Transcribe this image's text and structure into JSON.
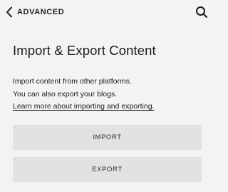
{
  "header": {
    "back_label": "ADVANCED",
    "back_icon": "chevron-left-icon",
    "search_icon": "search-icon"
  },
  "main": {
    "title": "Import & Export Content",
    "description_line1": "Import content from other platforms.",
    "description_line2": "You can also export your blogs.",
    "learn_more_link": "Learn more about importing and exporting.",
    "import_button": "IMPORT",
    "export_button": "EXPORT"
  },
  "colors": {
    "background": "#f3f3f3",
    "button_background": "#e2e2e2",
    "text": "#1d1d1d"
  }
}
